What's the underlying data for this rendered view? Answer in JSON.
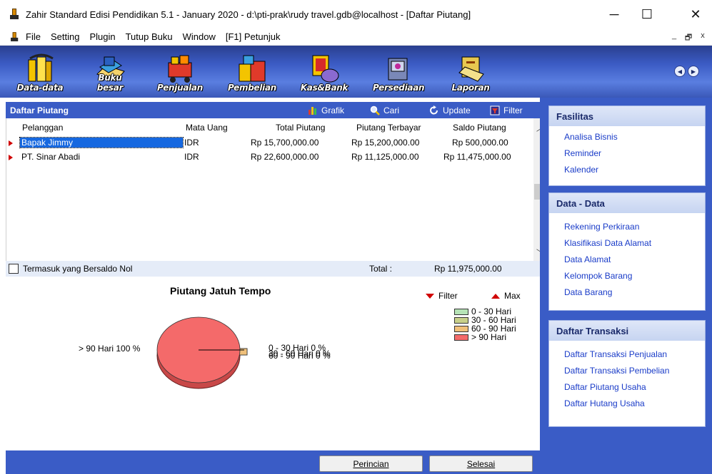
{
  "window": {
    "title": "Zahir Standard Edisi Pendidikan 5.1 - January 2020 - d:\\pti-prak\\rudy travel.gdb@localhost - [Daftar Piutang]",
    "minimize": "─",
    "maximize": "☐",
    "close": "✕"
  },
  "menu": {
    "items": [
      "File",
      "Setting",
      "Plugin",
      "Tutup Buku",
      "Window",
      "[F1] Petunjuk"
    ],
    "mdi_minimize": "_",
    "mdi_restore": "🗗",
    "mdi_close": "x"
  },
  "toolbar": {
    "tools": [
      {
        "label": "Data-data",
        "icon": "folders-icon"
      },
      {
        "label": "Buku besar",
        "icon": "ledger-book-icon"
      },
      {
        "label": "Penjualan",
        "icon": "shopping-cart-icon"
      },
      {
        "label": "Pembelian",
        "icon": "gift-boxes-icon"
      },
      {
        "label": "Kas&Bank",
        "icon": "money-bag-icon"
      },
      {
        "label": "Persediaan",
        "icon": "inventory-box-icon"
      },
      {
        "label": "Laporan",
        "icon": "report-scroll-icon"
      }
    ],
    "nav_prev": "◀",
    "nav_next": "▶"
  },
  "panel": {
    "title": "Daftar Piutang",
    "grafik": "Grafik",
    "cari": "Cari",
    "update": "Update",
    "filter": "Filter"
  },
  "grid": {
    "columns": [
      "Pelanggan",
      "Mata Uang",
      "Total Piutang",
      "Piutang Terbayar",
      "Saldo Piutang"
    ],
    "rows": [
      {
        "pelanggan": "Bapak Jimmy",
        "mata_uang": "IDR",
        "total": "Rp 15,700,000.00",
        "terbayar": "Rp 15,200,000.00",
        "saldo": "Rp 500,000.00"
      },
      {
        "pelanggan": "PT. Sinar Abadi",
        "mata_uang": "IDR",
        "total": "Rp 22,600,000.00",
        "terbayar": "Rp 11,125,000.00",
        "saldo": "Rp 11,475,000.00"
      }
    ]
  },
  "totals": {
    "checkbox_label": "Termasuk yang Bersaldo Nol",
    "total_label": "Total :",
    "total_value": "Rp 11,975,000.00"
  },
  "chart_data": {
    "type": "pie",
    "title": "Piutang Jatuh Tempo",
    "categories": [
      "0 - 30 Hari",
      "30 - 60 Hari",
      "60 - 90 Hari",
      "> 90 Hari"
    ],
    "values": [
      0,
      0,
      0,
      100
    ],
    "colors": [
      "#b6e3b6",
      "#c8d08a",
      "#f0c07a",
      "#f46a6a"
    ],
    "slice_labels": [
      "> 90 Hari 100 %",
      "0 - 30 Hari 0 %",
      "30 - 60 Hari 0 %",
      "60 - 90 Hari 0 %"
    ],
    "legend_filter": "Filter",
    "legend_max": "Max",
    "legend_position": "right"
  },
  "buttons": {
    "perincian": "Perincian",
    "selesai": "Selesai"
  },
  "sidebar": {
    "fasilitas": {
      "title": "Fasilitas",
      "links": [
        "Analisa Bisnis",
        "Reminder",
        "Kalender"
      ]
    },
    "data": {
      "title": "Data - Data",
      "links": [
        "Rekening Perkiraan",
        "Klasifikasi Data Alamat",
        "Data Alamat",
        "Kelompok Barang",
        "Data Barang"
      ]
    },
    "transaksi": {
      "title": "Daftar Transaksi",
      "links": [
        "Daftar Transaksi Penjualan",
        "Daftar Transaksi Pembelian",
        "Daftar Piutang Usaha",
        "Daftar Hutang Usaha"
      ]
    }
  }
}
